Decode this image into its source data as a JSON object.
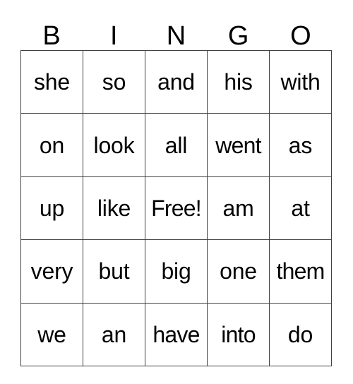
{
  "card": {
    "title": "BINGO",
    "headers": [
      "B",
      "I",
      "N",
      "G",
      "O"
    ],
    "free_space_label": "Free!",
    "free_space_position": {
      "row": 2,
      "col": 2
    },
    "colors": {
      "background": "#ffffff",
      "text": "#000000",
      "grid_line": "#404040"
    },
    "rows": [
      {
        "cells": [
          {
            "text": "she"
          },
          {
            "text": "so"
          },
          {
            "text": "and"
          },
          {
            "text": "his"
          },
          {
            "text": "with"
          }
        ]
      },
      {
        "cells": [
          {
            "text": "on"
          },
          {
            "text": "look"
          },
          {
            "text": "all"
          },
          {
            "text": "went"
          },
          {
            "text": "as"
          }
        ]
      },
      {
        "cells": [
          {
            "text": "up"
          },
          {
            "text": "like"
          },
          {
            "text": "Free!"
          },
          {
            "text": "am"
          },
          {
            "text": "at"
          }
        ]
      },
      {
        "cells": [
          {
            "text": "very"
          },
          {
            "text": "but"
          },
          {
            "text": "big"
          },
          {
            "text": "one"
          },
          {
            "text": "them"
          }
        ]
      },
      {
        "cells": [
          {
            "text": "we"
          },
          {
            "text": "an"
          },
          {
            "text": "have"
          },
          {
            "text": "into"
          },
          {
            "text": "do"
          }
        ]
      }
    ]
  }
}
